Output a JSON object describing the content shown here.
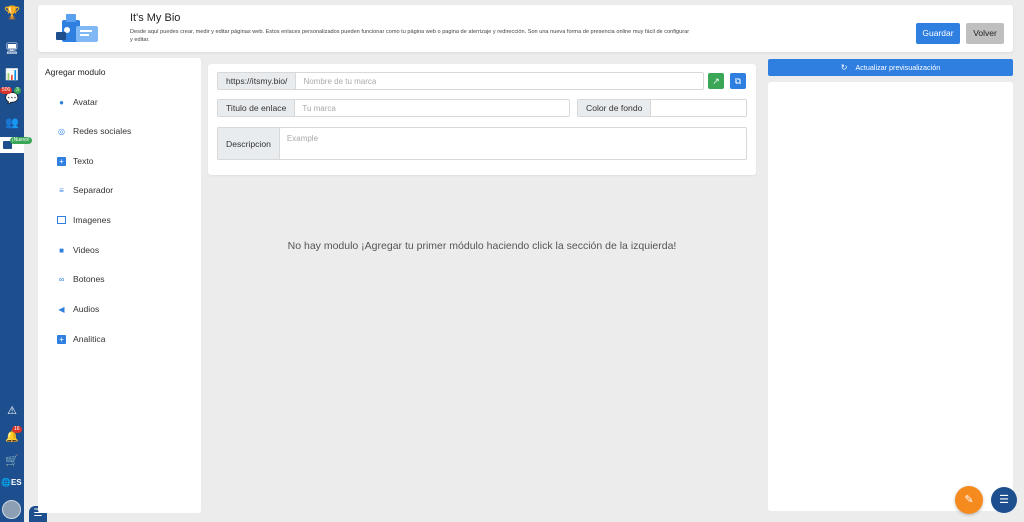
{
  "header": {
    "title": "It's My Bio",
    "description": "Desde aquí puedes crear, medir y editar páginas web. Estos enlaces personalizados pueden funcionar como tu página web o pagina de aterrizaje y redirección. Son una nueva forma de presencia online muy fácil de configurar y editar.",
    "save_label": "Guardar",
    "back_label": "Volver",
    "logo_icon": "bio-link-illustration-icon"
  },
  "rail": {
    "badges": {
      "messages": "500",
      "notifications_small": "3",
      "new": "¡Nuevo!",
      "alerts": "16"
    },
    "language": "ES",
    "icons": [
      "trophy-icon",
      "monitor-icon",
      "chart-icon",
      "chat-icon",
      "users-icon",
      "id-card-icon",
      "warning-icon",
      "bell-icon",
      "cart-icon",
      "globe-icon"
    ]
  },
  "modules": {
    "title": "Agregar modulo",
    "items": [
      {
        "label": "Avatar",
        "icon": "user-icon"
      },
      {
        "label": "Redes sociales",
        "icon": "instagram-icon"
      },
      {
        "label": "Texto",
        "icon": "plus-square-icon"
      },
      {
        "label": "Separador",
        "icon": "bars-icon"
      },
      {
        "label": "Imagenes",
        "icon": "image-icon"
      },
      {
        "label": "Videos",
        "icon": "video-icon"
      },
      {
        "label": "Botones",
        "icon": "link-icon"
      },
      {
        "label": "Audios",
        "icon": "volume-icon"
      },
      {
        "label": "Analitica",
        "icon": "plus-square-icon"
      }
    ]
  },
  "form": {
    "url_prefix": "https://itsmy.bio/",
    "brand_placeholder": "Nombre de tu marca",
    "link_title_label": "Titulo de enlace",
    "link_title_placeholder": "Tu marca",
    "bg_color_label": "Color de fondo",
    "description_label": "Descripcion",
    "description_placeholder": "Example"
  },
  "main": {
    "empty_message": "No hay modulo ¡Agregar tu primer módulo haciendo click la sección de la izquierda!"
  },
  "preview": {
    "refresh_label": "Actualizar previsualización"
  },
  "colors": {
    "primary": "#2f7fe0",
    "rail": "#1d4f8f",
    "success": "#3aa757",
    "fab": "#f58a1f"
  }
}
